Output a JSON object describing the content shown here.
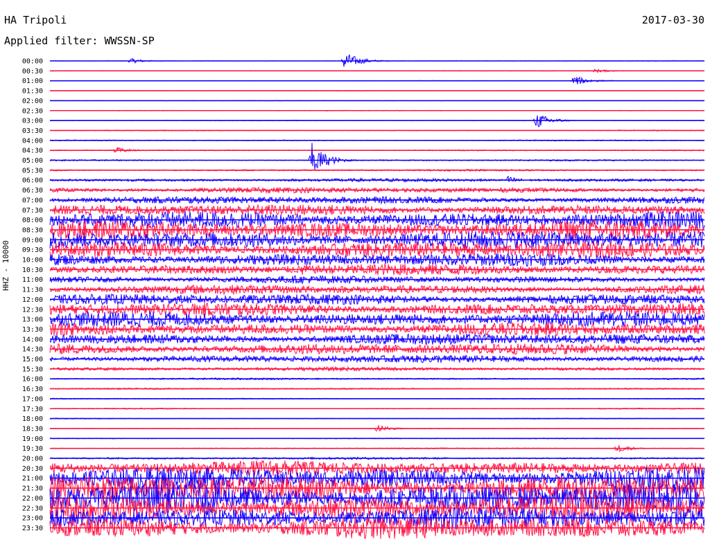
{
  "header": {
    "station": "HA Tripoli",
    "date": "2017-03-30",
    "filter": "Applied filter: WWSSN-SP"
  },
  "channel_label": "HHZ - 10000",
  "colors": {
    "odd_trace": "#1400ff",
    "even_trace": "#ff1446",
    "text": "#000000"
  },
  "chart_data": {
    "type": "line",
    "title": "HA Tripoli",
    "subtitle": "Applied filter: WWSSN-SP",
    "ylabel": "HHZ - 10000",
    "row_labels": [
      "00:00",
      "00:30",
      "01:00",
      "01:30",
      "02:00",
      "02:30",
      "03:00",
      "03:30",
      "04:00",
      "04:30",
      "05:00",
      "05:30",
      "06:00",
      "06:30",
      "07:00",
      "07:30",
      "08:00",
      "08:30",
      "09:00",
      "09:30",
      "10:00",
      "10:30",
      "11:00",
      "11:30",
      "12:00",
      "12:30",
      "13:00",
      "13:30",
      "14:00",
      "14:30",
      "15:00",
      "15:30",
      "16:00",
      "16:30",
      "17:00",
      "17:30",
      "18:00",
      "18:30",
      "19:00",
      "19:30",
      "20:00",
      "20:30",
      "21:00",
      "21:30",
      "22:00",
      "22:30",
      "23:00",
      "23:30"
    ],
    "noise_level": [
      0.3,
      0.3,
      0.3,
      0.3,
      0.3,
      0.4,
      0.4,
      0.5,
      0.6,
      0.6,
      0.8,
      1.0,
      1.8,
      3.0,
      4.0,
      6.0,
      9.0,
      10.0,
      10.0,
      9.0,
      7.0,
      6.0,
      4.0,
      5.0,
      6.0,
      7.0,
      8.0,
      7.0,
      6.0,
      6.0,
      4.0,
      2.0,
      1.0,
      0.8,
      0.6,
      0.6,
      0.5,
      0.5,
      0.5,
      0.6,
      1.2,
      8.0,
      12.0,
      14.0,
      16.0,
      14.0,
      12.0,
      12.0
    ],
    "events": [
      {
        "row": "00:00",
        "minute": 13.5,
        "amplitude": 14
      },
      {
        "row": "00:00",
        "minute": 3.7,
        "amplitude": 4
      },
      {
        "row": "00:30",
        "minute": 25.0,
        "amplitude": 3
      },
      {
        "row": "01:00",
        "minute": 24.0,
        "amplitude": 8
      },
      {
        "row": "03:00",
        "minute": 22.3,
        "amplitude": 12
      },
      {
        "row": "04:30",
        "minute": 3.0,
        "amplitude": 5
      },
      {
        "row": "05:00",
        "minute": 12.0,
        "amplitude": 26
      },
      {
        "row": "06:00",
        "minute": 21.0,
        "amplitude": 6
      },
      {
        "row": "10:30",
        "minute": 11.5,
        "amplitude": 12
      },
      {
        "row": "18:30",
        "minute": 15.0,
        "amplitude": 6
      },
      {
        "row": "19:30",
        "minute": 26.0,
        "amplitude": 6
      }
    ]
  }
}
